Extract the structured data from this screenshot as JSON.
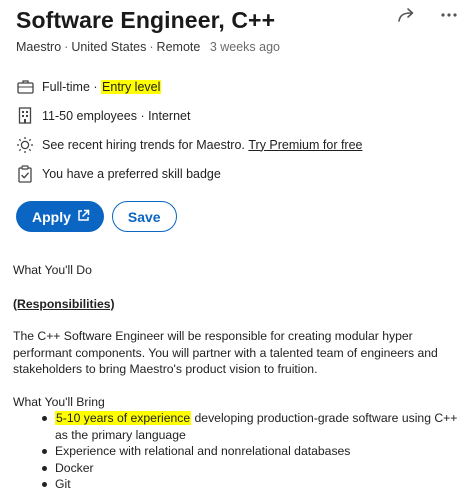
{
  "job": {
    "title": "Software Engineer, C++",
    "company": "Maestro",
    "location": "United States",
    "workplace": "Remote",
    "posted": "3 weeks ago"
  },
  "insights": {
    "job_type": "Full-time",
    "level": "Entry level",
    "company_size": "11-50 employees",
    "industry": "Internet",
    "hiring_trends_text": "See recent hiring trends for Maestro.",
    "premium_link": "Try Premium for free",
    "skill_badge": "You have a preferred skill badge"
  },
  "actions": {
    "apply_label": "Apply",
    "save_label": "Save"
  },
  "description": {
    "what_you_do": "What You'll Do",
    "responsibilities": "(Responsibilities)",
    "paragraph": "The C++ Software Engineer will be responsible for creating modular hyper performant components. You will partner with a talented team of engineers and stakeholders to bring Maestro's product vision to fruition.",
    "what_you_bring": "What You'll Bring",
    "bullets": {
      "b0_highlight": "5-10 years of experience",
      "b0_rest": " developing production-grade software using C++ as the primary language",
      "b1": "Experience with relational and nonrelational databases",
      "b2": "Docker",
      "b3": "Git"
    }
  },
  "colors": {
    "accent": "#0a66c2",
    "highlight": "#ffff00"
  },
  "icons": [
    "share-icon",
    "more-icon",
    "briefcase-icon",
    "building-icon",
    "lightbulb-icon",
    "checklist-icon",
    "external-link-icon"
  ]
}
